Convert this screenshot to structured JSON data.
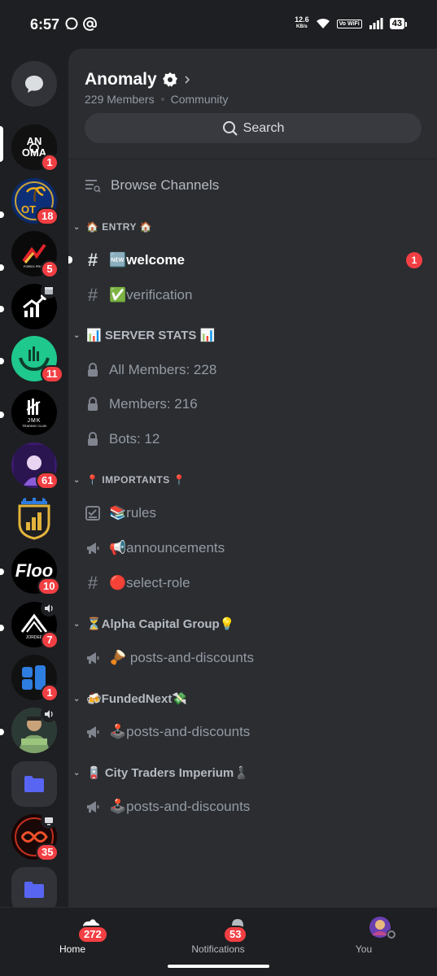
{
  "status_bar": {
    "time": "6:57",
    "speed_value": "12.6",
    "speed_unit": "KB/s",
    "vowifi": "Vo WiFi",
    "battery": "43"
  },
  "server": {
    "name": "Anomaly",
    "members": "229 Members",
    "type": "Community",
    "search_label": "Search"
  },
  "browse_label": "Browse Channels",
  "categories": [
    {
      "label": "🏠 ENTRY 🏠"
    },
    {
      "label": "📊 SERVER STATS 📊"
    },
    {
      "label": "📍 IMPORTANTS 📍"
    },
    {
      "label": "⏳Alpha Capital Group💡"
    },
    {
      "label": "🍻FundedNext💸"
    },
    {
      "label": "🪫 City Traders Imperium♟️"
    }
  ],
  "channels": {
    "welcome": {
      "label": "🆕welcome",
      "badge": "1"
    },
    "verification": {
      "label": "✅verification"
    },
    "all_members": {
      "label": "All Members: 228"
    },
    "members": {
      "label": "Members: 216"
    },
    "bots": {
      "label": "Bots: 12"
    },
    "rules": {
      "label": "📚rules"
    },
    "announcements": {
      "label": "📢announcements"
    },
    "select_role": {
      "label": "🔴select-role"
    },
    "alpha_posts": {
      "label": "🪘 posts-and-discounts"
    },
    "funded_posts": {
      "label": "🕹️posts-and-discounts"
    },
    "cti_posts": {
      "label": "🕹️posts-and-discounts"
    }
  },
  "rail": {
    "servers": [
      {
        "name": "Anomaly",
        "badge": "1"
      },
      {
        "name": "OT",
        "badge": "18"
      },
      {
        "name": "Forex",
        "badge": "5"
      },
      {
        "name": "Chart",
        "badge": ""
      },
      {
        "name": "Green",
        "badge": "11"
      },
      {
        "name": "JMK",
        "initials": "JMK",
        "subtitle": "TRADING CLUB",
        "badge": ""
      },
      {
        "name": "Purple",
        "badge": "61"
      },
      {
        "name": "Gold",
        "badge": ""
      },
      {
        "name": "Floo",
        "label": "Floo",
        "badge": "10"
      },
      {
        "name": "Jordee",
        "badge": "7"
      },
      {
        "name": "Blue",
        "badge": "1"
      },
      {
        "name": "Money",
        "badge": ""
      },
      {
        "name": "Folder",
        "badge": ""
      },
      {
        "name": "Red",
        "badge": "35"
      },
      {
        "name": "Folder2",
        "badge": ""
      }
    ]
  },
  "bottom_nav": {
    "home": {
      "label": "Home",
      "badge": "272"
    },
    "notifications": {
      "label": "Notifications",
      "badge": "53"
    },
    "you": {
      "label": "You"
    }
  }
}
